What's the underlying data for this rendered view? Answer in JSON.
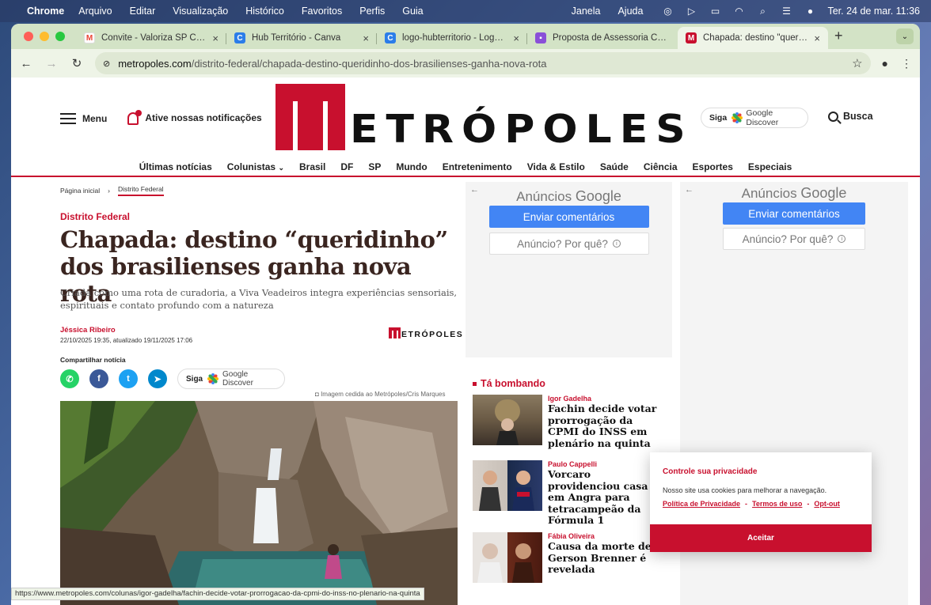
{
  "menubar": {
    "app": "Chrome",
    "items": [
      "Arquivo",
      "Editar",
      "Visualização",
      "Histórico",
      "Favoritos",
      "Perfis",
      "Guia"
    ],
    "right_items": [
      "Janela",
      "Ajuda"
    ],
    "datetime": "Ter. 24 de mar.  11:36"
  },
  "tabs": [
    {
      "title": "Convite - Valoriza SP Cotia -",
      "icon": "gmail-icon",
      "color": "#ea4335"
    },
    {
      "title": "Hub Território - Canva",
      "icon": "canva-icon",
      "color": "#2b7de9"
    },
    {
      "title": "logo-hubterritorio - Logotipo",
      "icon": "canva-icon",
      "color": "#2b7de9"
    },
    {
      "title": "Proposta de Assessoria Corpo",
      "icon": "doc-icon",
      "color": "#8a4fd8"
    },
    {
      "title": "Chapada: destino \"queridinho",
      "icon": "metropoles-icon",
      "color": "#c8102e"
    }
  ],
  "address": {
    "domain": "metropoles.com",
    "path": "/distrito-federal/chapada-destino-queridinho-dos-brasilienses-ganha-nova-rota"
  },
  "header": {
    "menu_label": "Menu",
    "notify_label": "Ative nossas notificações",
    "logo_text": "ETRÓPOLES",
    "siga_label": "Siga",
    "discover_label": "Google Discover",
    "search_label": "Busca"
  },
  "nav": [
    "Últimas notícias",
    "Colunistas",
    "Brasil",
    "DF",
    "SP",
    "Mundo",
    "Entretenimento",
    "Vida & Estilo",
    "Saúde",
    "Ciência",
    "Esportes",
    "Especiais"
  ],
  "breadcrumb": {
    "home": "Página inicial",
    "current": "Distrito Federal"
  },
  "article": {
    "section": "Distrito Federal",
    "headline": "Chapada: destino “queridinho” dos brasilienses ganha nova rota",
    "subtitle": "Criada como uma rota de curadoria, a Viva Veadeiros integra experiências sensoriais, espirituais e contato profundo com a natureza",
    "author": "Jéssica Ribeiro",
    "dates": "22/10/2025 19:35, atualizado 19/11/2025 17:06",
    "mini_logo": "ETRÓPOLES",
    "share_label": "Compartilhar notícia",
    "photo_credit": "Imagem cedida ao Metrópoles/Cris Marques"
  },
  "ads": {
    "label_prefix": "Anúncios",
    "label_brand": "Google",
    "feedback_button": "Enviar comentários",
    "why_button": "Anúncio? Por quê?"
  },
  "trending": {
    "title": "Tá bombando",
    "items": [
      {
        "author": "Igor Gadelha",
        "headline": "Fachin decide votar prorrogação da CPMI do INSS em plenário na quinta"
      },
      {
        "author": "Paulo Cappelli",
        "headline": "Vorcaro providenciou casa em Angra para tetracampeão da Fórmula 1"
      },
      {
        "author": "Fábia Oliveira",
        "headline": "Causa da morte de Gerson Brenner é revelada"
      }
    ]
  },
  "cookie": {
    "title": "Controle sua privacidade",
    "desc": "Nosso site usa cookies para melhorar a navegação.",
    "link1": "Política de Privacidade",
    "link2": "Termos de uso",
    "link3": "Opt-out",
    "sep": "-",
    "accept": "Aceitar"
  },
  "statusbar": "https://www.metropoles.com/colunas/igor-gadelha/fachin-decide-votar-prorrogacao-da-cpmi-do-inss-no-plenario-na-quinta"
}
